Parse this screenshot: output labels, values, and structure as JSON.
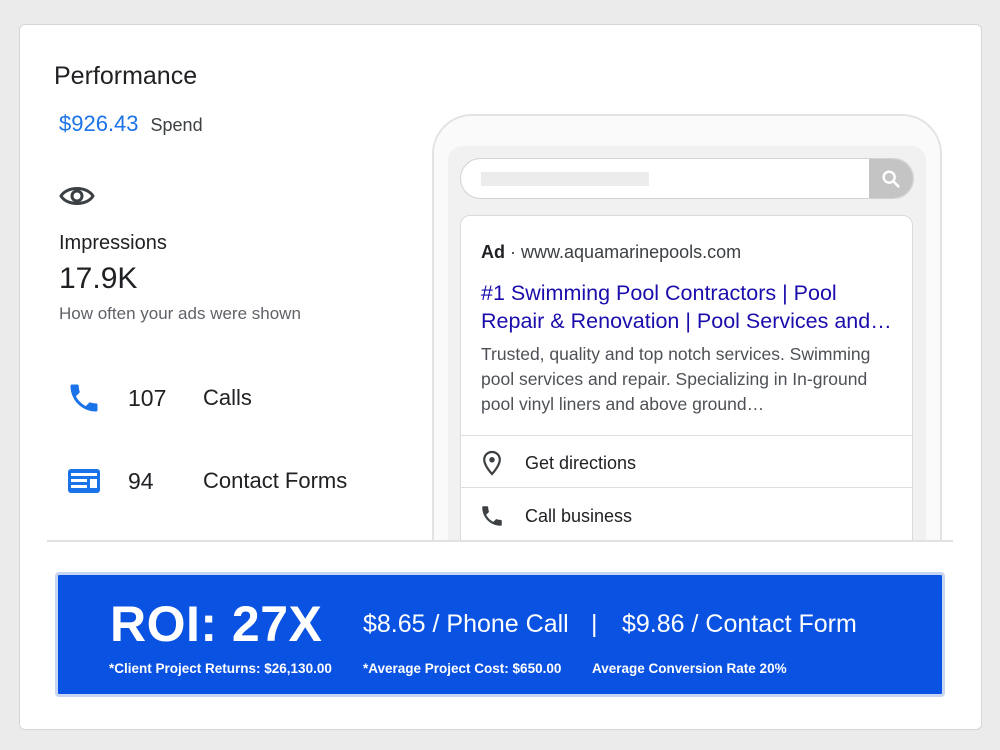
{
  "performance": {
    "title": "Performance",
    "spend_value": "$926.43",
    "spend_label": "Spend",
    "impressions_label": "Impressions",
    "impressions_value": "17.9K",
    "impressions_desc": "How often your ads were shown",
    "metrics": [
      {
        "icon": "phone-icon",
        "value": "107",
        "label": "Calls"
      },
      {
        "icon": "contact-form-icon",
        "value": "94",
        "label": "Contact Forms"
      }
    ]
  },
  "ad_preview": {
    "badge": "Ad",
    "separator": "·",
    "url": "www.aquamarinepools.com",
    "title": "#1 Swimming Pool Contractors | Pool Repair & Renovation | Pool Services and…",
    "description": "Trusted, quality and top notch services. Swimming pool services and repair. Specializing in In-ground pool vinyl liners and above ground…",
    "actions": [
      {
        "icon": "location-pin-icon",
        "label": "Get directions"
      },
      {
        "icon": "phone-icon",
        "label": "Call business"
      }
    ]
  },
  "roi": {
    "headline": "ROI: 27X",
    "phone_call_stat": "$8.65 / Phone Call",
    "divider": "|",
    "contact_form_stat": "$9.86 / Contact Form",
    "note_returns": "*Client Project Returns: $26,130.00",
    "note_cost": "*Average Project Cost: $650.00",
    "note_conversion": "Average Conversion Rate 20%"
  },
  "colors": {
    "accent_blue": "#1a73e8",
    "banner_blue": "#0a52e1",
    "ad_title": "#1a0dab"
  }
}
